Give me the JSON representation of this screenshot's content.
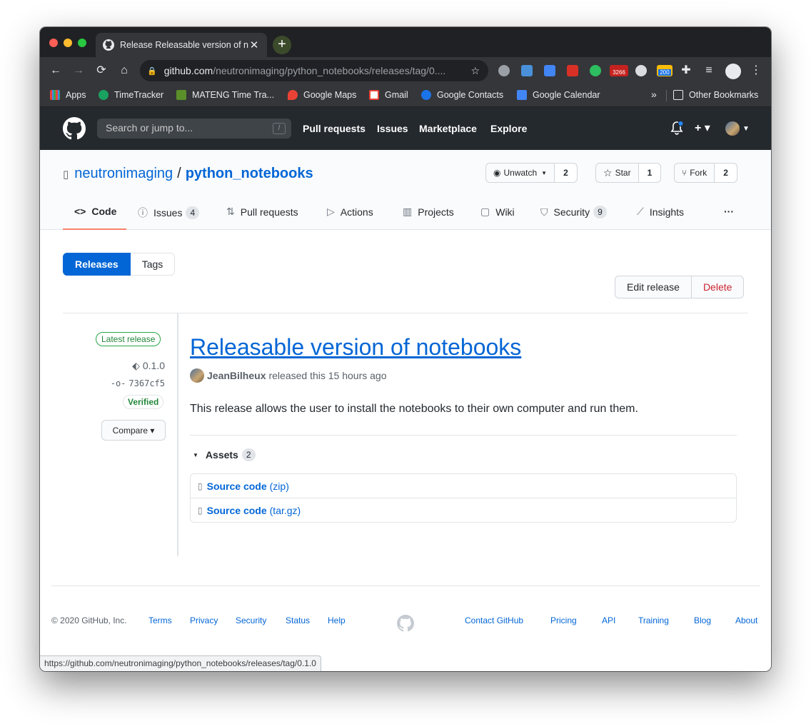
{
  "browser": {
    "tab_title": "Release Releasable version of notebooks",
    "tab_close": "✕",
    "new_tab": "+",
    "url_host": "github.com",
    "url_rest": "/neutronimaging/python_notebooks/releases/tag/0....",
    "ext_badge_1": "3266",
    "ext_badge_2": "200",
    "status_url": "https://github.com/neutronimaging/python_notebooks/releases/tag/0.1.0"
  },
  "bookmarks": {
    "items": [
      "Apps",
      "TimeTracker",
      "MATENG Time Tra...",
      "Google Maps",
      "Gmail",
      "Google Contacts",
      "Google Calendar"
    ],
    "more": "»",
    "other": "Other Bookmarks"
  },
  "gh_header": {
    "search_placeholder": "Search or jump to...",
    "slash": "/",
    "nav": [
      "Pull requests",
      "Issues",
      "Marketplace",
      "Explore"
    ],
    "plus": "+ ▾"
  },
  "repo": {
    "owner": "neutronimaging",
    "sep": "/",
    "name": "python_notebooks",
    "watch_label": "Unwatch",
    "watch_count": "2",
    "star_label": "Star",
    "star_count": "1",
    "fork_label": "Fork",
    "fork_count": "2",
    "tabs": [
      {
        "label": "Code"
      },
      {
        "label": "Issues",
        "count": "4"
      },
      {
        "label": "Pull requests"
      },
      {
        "label": "Actions"
      },
      {
        "label": "Projects"
      },
      {
        "label": "Wiki"
      },
      {
        "label": "Security",
        "count": "9"
      },
      {
        "label": "Insights"
      }
    ],
    "more": "···"
  },
  "release_page": {
    "segment_releases": "Releases",
    "segment_tags": "Tags",
    "edit": "Edit release",
    "delete": "Delete",
    "latest_badge": "Latest release",
    "tag": "0.1.0",
    "commit": "7367cf5",
    "verified": "Verified",
    "compare": "Compare ▾",
    "title": "Releasable version of notebooks",
    "author": "JeanBilheux",
    "released_text": "released this 15 hours ago",
    "body": "This release allows the user to install the notebooks to their own computer and run them.",
    "assets_label": "Assets",
    "assets_count": "2",
    "assets": [
      {
        "name": "Source code",
        "ext": "(zip)"
      },
      {
        "name": "Source code",
        "ext": "(tar.gz)"
      }
    ]
  },
  "footer": {
    "copyright": "© 2020 GitHub, Inc.",
    "left_links": [
      "Terms",
      "Privacy",
      "Security",
      "Status",
      "Help"
    ],
    "right_links": [
      "Contact GitHub",
      "Pricing",
      "API",
      "Training",
      "Blog",
      "About"
    ]
  },
  "colors": {
    "link": "#0366d6",
    "header_bg": "#24292e",
    "active_tab_underline": "#f9826c",
    "danger": "#cb2431",
    "success": "#22863a"
  }
}
